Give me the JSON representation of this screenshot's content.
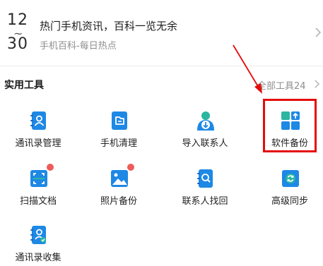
{
  "news": {
    "date_month": "12",
    "date_day": "30",
    "date_separator": "~",
    "title": "热门手机资讯，百科一览无余",
    "subtitle": "手机百科-每日热点",
    "chevron_icon": "chevron-right-icon"
  },
  "tools_section": {
    "title": "实用工具",
    "all_tools_label": "全部工具24",
    "chevron_icon": "chevron-right-icon"
  },
  "tools": [
    {
      "label": "通讯录管理",
      "icon": "contacts-book-icon",
      "badge": false
    },
    {
      "label": "手机清理",
      "icon": "phone-clean-icon",
      "badge": false
    },
    {
      "label": "导入联系人",
      "icon": "import-contact-icon",
      "badge": false
    },
    {
      "label": "软件备份",
      "icon": "app-backup-icon",
      "badge": false
    },
    {
      "label": "扫描文档",
      "icon": "scan-document-icon",
      "badge": true
    },
    {
      "label": "照片备份",
      "icon": "photo-backup-icon",
      "badge": true
    },
    {
      "label": "联系人找回",
      "icon": "contact-recover-icon",
      "badge": false
    },
    {
      "label": "高级同步",
      "icon": "advanced-sync-icon",
      "badge": false
    },
    {
      "label": "通讯录收集",
      "icon": "contacts-collect-icon",
      "badge": false
    }
  ],
  "colors": {
    "accent_blue": "#1e88e5",
    "badge_red": "#ee5c58",
    "annotation_red": "#e40b0b"
  }
}
